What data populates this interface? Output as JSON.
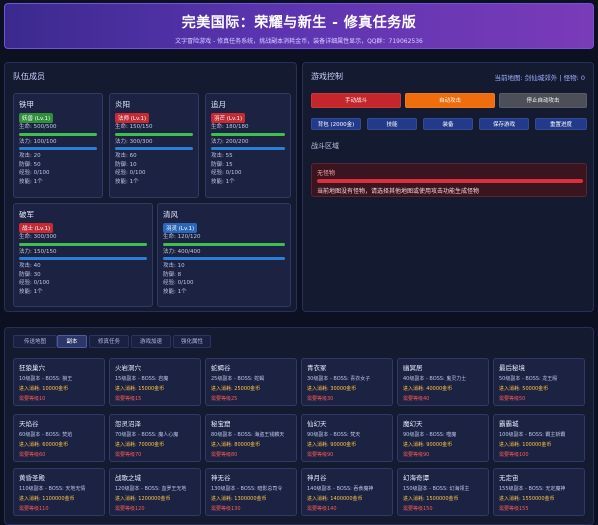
{
  "header": {
    "title": "完美国际：荣耀与新生 - 修真任务版",
    "subtitle": "文字冒险游戏 - 修真任务系统，挑战副本消耗金币，装备详细属性显示，QQ群：719062536"
  },
  "team": {
    "title": "队伍成员",
    "members": [
      {
        "name": "铁甲",
        "badge": "妖兽 (Lv.1)",
        "hp": "生命: 500/500",
        "mp": "法力: 100/100",
        "atk": "攻击: 20",
        "def": "防御: 50",
        "exp": "经验: 0/100",
        "skills": "技能: 1个"
      },
      {
        "name": "炎阳",
        "badge": "法师 (Lv.1)",
        "hp": "生命: 150/150",
        "mp": "法力: 300/300",
        "atk": "攻击: 60",
        "def": "防御: 10",
        "exp": "经验: 0/100",
        "skills": "技能: 1个"
      },
      {
        "name": "追月",
        "badge": "羽芒 (Lv.1)",
        "hp": "生命: 180/180",
        "mp": "法力: 200/200",
        "atk": "攻击: 55",
        "def": "防御: 15",
        "exp": "经验: 0/100",
        "skills": "技能: 1个"
      },
      {
        "name": "破军",
        "badge": "战士 (Lv.1)",
        "hp": "生命: 300/300",
        "mp": "法力: 150/150",
        "atk": "攻击: 40",
        "def": "防御: 30",
        "exp": "经验: 0/100",
        "skills": "技能: 1个"
      },
      {
        "name": "清风",
        "badge": "羽灵 (Lv.1)",
        "hp": "生命: 120/120",
        "mp": "法力: 400/400",
        "atk": "攻击: 10",
        "def": "防御: 8",
        "exp": "经验: 0/100",
        "skills": "技能: 1个"
      }
    ]
  },
  "control": {
    "title": "游戏控制",
    "map_info": "当前地图: 剑仙城郊外 | 怪物: 0",
    "buttons": [
      "手动战斗",
      "自动攻击",
      "停止自动攻击"
    ],
    "small_buttons": [
      "背包 (2000金)",
      "技能",
      "装备",
      "保存游戏",
      "重置进度"
    ],
    "battle_title": "战斗区域",
    "monster": "无怪物",
    "message": "当前地图没有怪物，请选择其他地图或使用攻击功能生成怪物"
  },
  "dungeon": {
    "tabs": [
      "传送地图",
      "副本",
      "修真任务",
      "游戏加速",
      "强化属性"
    ],
    "cards": [
      {
        "name": "狂狼巢穴",
        "level": "10级副本 - BOSS: 狼王",
        "cost": "进入消耗: 10000金币",
        "need": "需要等级10"
      },
      {
        "name": "火岩洞穴",
        "level": "15级副本 - BOSS: 岩魔",
        "cost": "进入消耗: 15000金币",
        "need": "需要等级15"
      },
      {
        "name": "蛇蝎谷",
        "level": "25级副本 - BOSS: 蛇蝎",
        "cost": "进入消耗: 25000金币",
        "need": "需要等级25"
      },
      {
        "name": "青衣冢",
        "level": "30级副本 - BOSS: 青衣女子",
        "cost": "进入消耗: 30000金币",
        "need": "需要等级30"
      },
      {
        "name": "幽冥居",
        "level": "40级副本 - BOSS: 鬼灵力士",
        "cost": "进入消耗: 40000金币",
        "need": "需要等级40"
      },
      {
        "name": "最后秘境",
        "level": "50级副本 - BOSS: 龙王殿",
        "cost": "进入消耗: 50000金币",
        "need": "需要等级50"
      },
      {
        "name": "天焰谷",
        "level": "60级副本 - BOSS: 焚焰",
        "cost": "进入消耗: 60000金币",
        "need": "需要等级60"
      },
      {
        "name": "怨灵沼泽",
        "level": "70级副本 - BOSS: 魔人心魔",
        "cost": "进入消耗: 70000金币",
        "need": "需要等级70"
      },
      {
        "name": "秘宝窟",
        "level": "80级副本 - BOSS: 海盗王钱麟天",
        "cost": "进入消耗: 80000金币",
        "need": "需要等级80"
      },
      {
        "name": "仙幻天",
        "level": "90级副本 - BOSS: 梵天",
        "cost": "进入消耗: 90000金币",
        "need": "需要等级90"
      },
      {
        "name": "魔幻天",
        "level": "90级副本 - BOSS: 噬魔",
        "cost": "进入消耗: 90000金币",
        "need": "需要等级90"
      },
      {
        "name": "霸霸城",
        "level": "100级副本 - BOSS: 霸主斩霸",
        "cost": "进入消耗: 100000金币",
        "need": "需要等级100"
      },
      {
        "name": "黄昏圣殿",
        "level": "110级副本 - BOSS: 天地无情",
        "cost": "进入消耗: 1100000金币",
        "need": "需要等级110"
      },
      {
        "name": "战歌之城",
        "level": "120级副本 - BOSS: 血罗王无地",
        "cost": "进入消耗: 1200000金币",
        "need": "需要等级120"
      },
      {
        "name": "神无谷",
        "level": "130级副本 - BOSS: 暗影总司令",
        "cost": "进入消耗: 1300000金币",
        "need": "需要等级130"
      },
      {
        "name": "神月谷",
        "level": "140级副本 - BOSS: 吞食魔神",
        "cost": "进入消耗: 1400000金币",
        "need": "需要等级140"
      },
      {
        "name": "幻海奇谭",
        "level": "150级副本 - BOSS: 幻海领主",
        "cost": "进入消耗: 1500000金币",
        "need": "需要等级150"
      },
      {
        "name": "无定宙",
        "level": "155级副本 - BOSS: 无定魔神",
        "cost": "进入消耗: 1550000金币",
        "need": "需要等级155"
      }
    ]
  },
  "colors": {
    "badge_beast": "#2f8f3a",
    "badge_mage": "#c62b34",
    "badge_archer": "#c62b34",
    "badge_warrior": "#c62b34",
    "badge_priest": "#2b66b8"
  }
}
